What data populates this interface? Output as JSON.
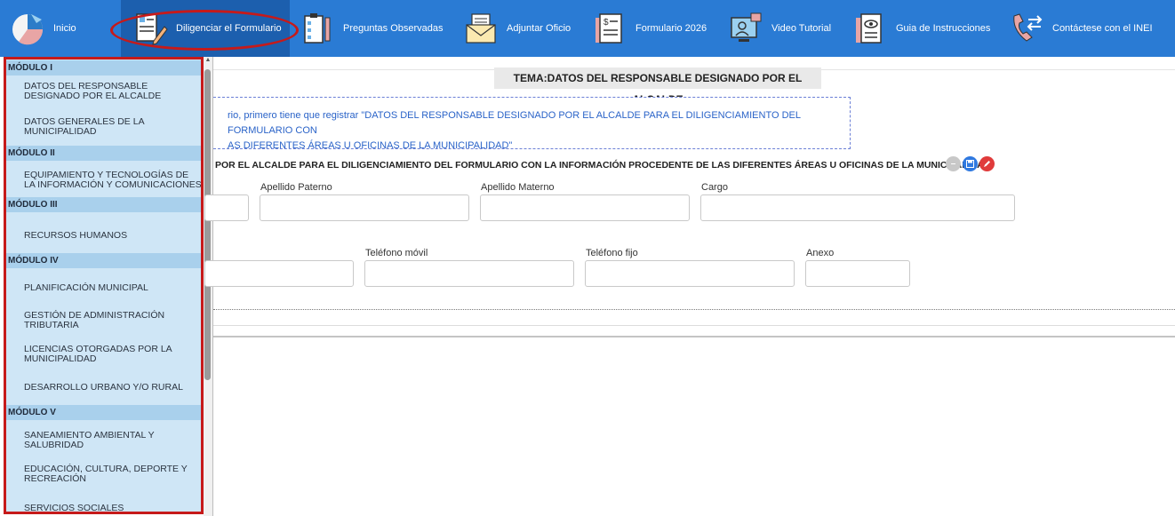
{
  "nav": {
    "items": [
      {
        "label": "Inicio",
        "icon": "pie-chart-icon"
      },
      {
        "label": "Diligenciar el Formulario",
        "icon": "form-edit-icon"
      },
      {
        "label": "Preguntas Observadas",
        "icon": "clipboard-icon"
      },
      {
        "label": "Adjuntar Oficio",
        "icon": "envelope-icon"
      },
      {
        "label": "Formulario 2026",
        "icon": "invoice-icon"
      },
      {
        "label": "Video Tutorial",
        "icon": "video-tutorial-icon"
      },
      {
        "label": "Guia de Instrucciones",
        "icon": "guide-eye-icon"
      },
      {
        "label": "Contáctese con el INEI",
        "icon": "phone-contact-icon"
      }
    ],
    "colors": {
      "bar": "#2a7bd4",
      "active": "#1c5fae",
      "highlight": "#c61a1a"
    }
  },
  "sidebar": {
    "modules": [
      {
        "header": "MÓDULO I",
        "items": [
          "DATOS DEL RESPONSABLE DESIGNADO POR EL ALCALDE",
          "DATOS GENERALES DE LA MUNICIPALIDAD"
        ]
      },
      {
        "header": "MÓDULO II",
        "items": [
          "EQUIPAMIENTO Y TECNOLOGÍAS DE LA INFORMACIÓN Y COMUNICACIONES"
        ]
      },
      {
        "header": "MÓDULO III",
        "items": [
          "RECURSOS HUMANOS"
        ]
      },
      {
        "header": "MÓDULO IV",
        "items": [
          "PLANIFICACIÓN MUNICIPAL",
          "GESTIÓN DE ADMINISTRACIÓN TRIBUTARIA",
          "LICENCIAS OTORGADAS POR LA MUNICIPALIDAD",
          "DESARROLLO URBANO Y/O RURAL"
        ]
      },
      {
        "header": "MÓDULO V",
        "items": [
          "SANEAMIENTO AMBIENTAL Y SALUBRIDAD",
          "EDUCACIÓN, CULTURA, DEPORTE Y RECREACIÓN",
          "SERVICIOS SOCIALES"
        ]
      }
    ],
    "colors": {
      "background": "#cfe6f6",
      "header": "#a9d0ec"
    }
  },
  "main": {
    "tema_label": "TEMA:",
    "tema_title": "DATOS DEL RESPONSABLE DESIGNADO POR EL ALCALDE",
    "info_line1": "rio, primero tiene que registrar \"DATOS DEL RESPONSABLE DESIGNADO POR EL ALCALDE PARA EL DILIGENCIAMIENTO DEL FORMULARIO CON",
    "info_line2": "AS DIFERENTES ÁREAS U OFICINAS DE LA MUNICIPALIDAD\"",
    "section_title": "POR EL ALCALDE PARA EL DILIGENCIAMIENTO DEL FORMULARIO CON LA INFORMACIÓN PROCEDENTE DE LAS DIFERENTES ÁREAS U OFICINAS DE LA MUNICIPALIDAD",
    "buttons": [
      {
        "icon": "minus-icon",
        "color": "#c8c8c8"
      },
      {
        "icon": "save-icon",
        "color": "#2f79e0"
      },
      {
        "icon": "edit-icon",
        "color": "#e03b3b"
      }
    ],
    "fields": {
      "apellido_paterno": "Apellido Paterno",
      "apellido_materno": "Apellido Materno",
      "cargo": "Cargo",
      "telefono_movil": "Teléfono móvil",
      "telefono_fijo": "Teléfono fijo",
      "anexo": "Anexo"
    }
  }
}
